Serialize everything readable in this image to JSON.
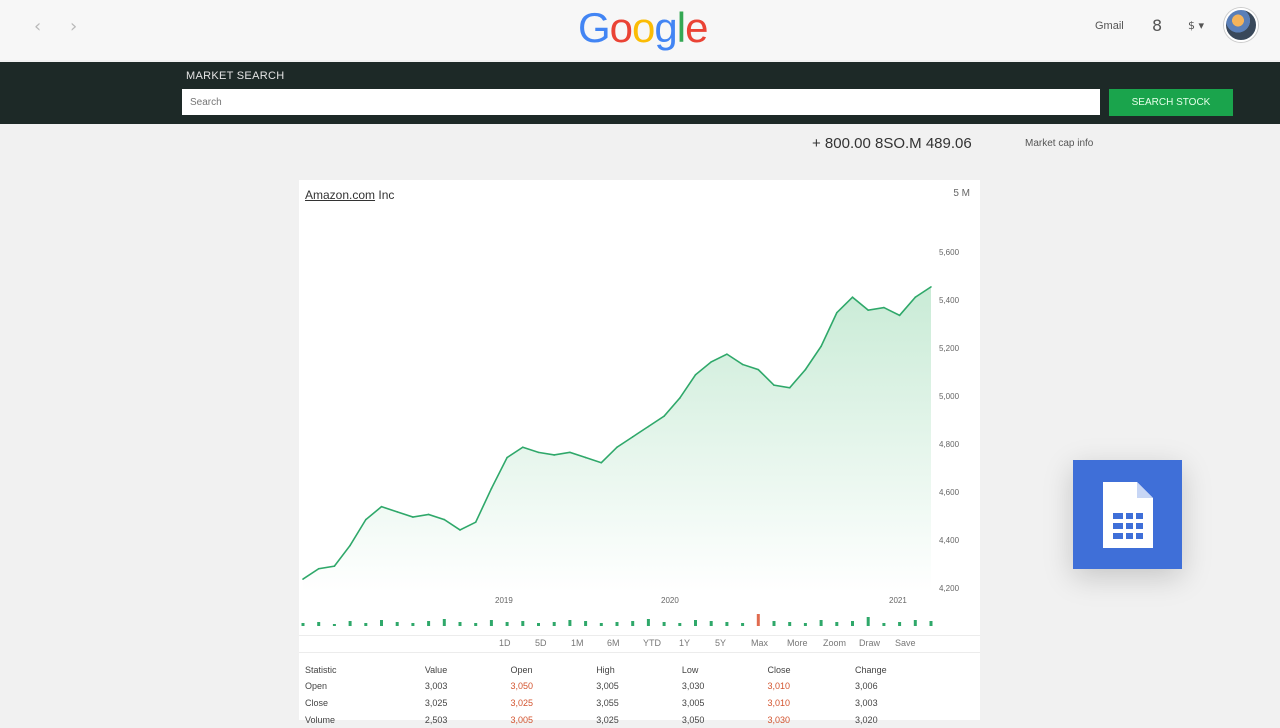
{
  "browser": {
    "back_icon": "chevron-left-icon",
    "forward_icon": "chevron-right-icon",
    "logo": "Google",
    "logo_colors": [
      "#4285f4",
      "#ea4335",
      "#fbbc05",
      "#4285f4",
      "#34a853",
      "#ea4335"
    ],
    "account_label": "Gmail",
    "apps_icon": "apps-icon",
    "settings_glyph": "$ ▾"
  },
  "search": {
    "label": "MARKET SEARCH",
    "placeholder": "Search",
    "button_label": "SEARCH STOCK"
  },
  "quote": {
    "line": "+ 800.00  8SO.M  489.06",
    "subtext": "Market cap info"
  },
  "chart_card": {
    "title": "Amazon.com",
    "title_suffix": "Inc",
    "range": "5 M",
    "y_ticks": [
      "5,600",
      "5,400",
      "5,200",
      "5,000",
      "4,800",
      "4,600",
      "4,400",
      "4,200"
    ],
    "x_ticks": [
      "2019",
      "2020",
      "2021"
    ],
    "toolbar_items": [
      "1D",
      "5D",
      "1M",
      "6M",
      "YTD",
      "1Y",
      "5Y",
      "Max",
      "More",
      "Zoom",
      "Draw",
      "Save"
    ]
  },
  "chart_data": {
    "type": "area",
    "x": [
      0,
      1,
      2,
      3,
      4,
      5,
      6,
      7,
      8,
      9,
      10,
      11,
      12,
      13,
      14,
      15,
      16,
      17,
      18,
      19,
      20,
      21,
      22,
      23,
      24,
      25,
      26,
      27,
      28,
      29,
      30,
      31,
      32,
      33,
      34,
      35,
      36,
      37,
      38,
      39,
      40
    ],
    "values": [
      4250,
      4290,
      4300,
      4380,
      4480,
      4530,
      4510,
      4490,
      4500,
      4480,
      4440,
      4470,
      4600,
      4720,
      4760,
      4740,
      4730,
      4740,
      4720,
      4700,
      4760,
      4800,
      4840,
      4880,
      4950,
      5040,
      5090,
      5120,
      5080,
      5060,
      5000,
      4990,
      5060,
      5150,
      5280,
      5340,
      5290,
      5300,
      5270,
      5340,
      5380
    ],
    "ylim": [
      4200,
      5600
    ],
    "color": "#2fa86a",
    "fill_top": "#c9ebd6",
    "volume": [
      3,
      4,
      2,
      5,
      3,
      6,
      4,
      3,
      5,
      7,
      4,
      3,
      6,
      4,
      5,
      3,
      4,
      6,
      5,
      3,
      4,
      5,
      7,
      4,
      3,
      6,
      5,
      4,
      3,
      12,
      5,
      4,
      3,
      6,
      4,
      5,
      9,
      3,
      4,
      6,
      5
    ]
  },
  "table": {
    "headers": [
      "Statistic",
      "Value",
      "Open",
      "High",
      "Low",
      "Close",
      "Change"
    ],
    "rows": [
      [
        "Open",
        "3,003",
        "3,050",
        "3,005",
        "3,030",
        "3,010",
        "3,006"
      ],
      [
        "Close",
        "3,025",
        "3,025",
        "3,055",
        "3,005",
        "3,010",
        "3,003"
      ],
      [
        "Volume",
        "2,503",
        "3,005",
        "3,025",
        "3,050",
        "3,030",
        "3,020"
      ]
    ]
  },
  "floating_icon": "document-sheet-icon",
  "colors": {
    "band": "#1d2927",
    "accent": "#1aa44c",
    "doc_tile": "#3f6fd8"
  }
}
